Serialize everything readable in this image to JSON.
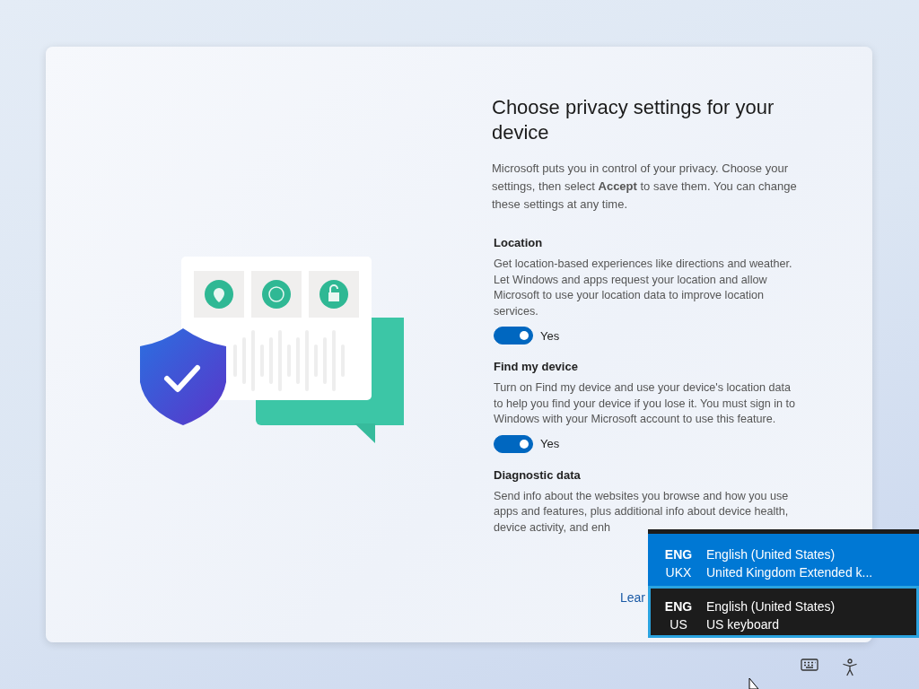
{
  "setup": {
    "title": "Choose privacy settings for your device",
    "intro": "Microsoft puts you in control of your privacy. Choose your settings, then select **Accept** to save them. You can change these settings at any time.",
    "settings": [
      {
        "kind": "toggle",
        "heading": "Location",
        "description": "Get location-based experiences like directions and weather. Let Windows and apps request your location and allow Microsoft to use your location data to improve location services.",
        "on": true,
        "state_label": "Yes"
      },
      {
        "kind": "toggle",
        "heading": "Find my device",
        "description": "Turn on Find my device and use your device's location data to help you find your device if you lose it. You must sign in to Windows with your Microsoft account to use this feature.",
        "on": true,
        "state_label": "Yes"
      },
      {
        "kind": "text",
        "heading": "Diagnostic data",
        "description": "Send info about the websites you browse and how you use apps and features, plus additional info about device health, device activity, and enh"
      }
    ],
    "link": "Lear"
  },
  "input_switcher": [
    {
      "language": "ENG",
      "code": "UKX",
      "name": "English (United States)",
      "layout": "United Kingdom Extended k...",
      "selected": true,
      "focused": false
    },
    {
      "language": "ENG",
      "code": "US",
      "name": "English (United States)",
      "layout": "US keyboard",
      "selected": false,
      "focused": true
    }
  ]
}
